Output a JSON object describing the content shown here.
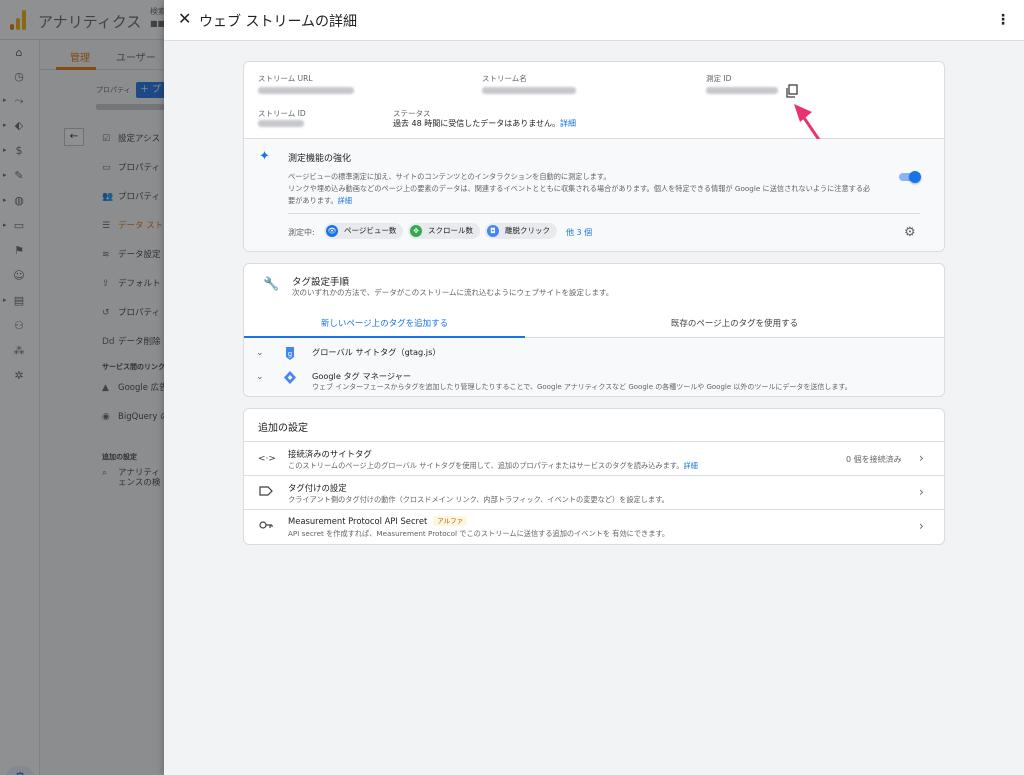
{
  "background": {
    "app_title": "アナリティクス",
    "account_lines": [
      "検索",
      "■■"
    ],
    "tabs": [
      "管理",
      "ユーザー"
    ],
    "property_label": "プロパティ",
    "create_button": "＋ プ",
    "menu": [
      {
        "icon": "☑",
        "label": "設定アシス"
      },
      {
        "icon": "▭",
        "label": "プロパティ"
      },
      {
        "icon": "👥",
        "label": "プロパティ"
      },
      {
        "icon": "☰",
        "label": "データ スト"
      },
      {
        "icon": "≋",
        "label": "データ設定"
      },
      {
        "icon": "⇪",
        "label": "デフォルト"
      },
      {
        "icon": "↺",
        "label": "プロパティ"
      },
      {
        "icon": "Dd",
        "label": "データ削除"
      }
    ],
    "section_links": "サービス間のリンク",
    "links": [
      {
        "label": "Google 広告"
      },
      {
        "label": "BigQuery の"
      }
    ],
    "section_extra": "追加の設定",
    "extra_item": {
      "label_1": "アナリティ",
      "label_2": "ェンスの検"
    }
  },
  "panel": {
    "title": "ウェブ ストリームの詳細",
    "close_glyph": "✕",
    "more_glyph": "⋮"
  },
  "details": {
    "stream_url_label": "ストリーム URL",
    "stream_name_label": "ストリーム名",
    "measurement_id_label": "測定 ID",
    "stream_id_label": "ストリーム ID",
    "status_label": "ステータス",
    "status_text": "過去 48 時間に受信したデータはありません。",
    "status_link": "詳細"
  },
  "enhanced": {
    "title": "測定機能の強化",
    "desc_1": "ページビューの標準測定に加え、サイトのコンテンツとのインタラクションを自動的に測定します。",
    "desc_2": "リンクや埋め込み動画などのページ上の要素のデータは、関連するイベントとともに収集される場合があります。個人を特定できる情報が Google に送信されないように注意する必",
    "desc_3": "要があります。",
    "desc_link": "詳細",
    "toggle_on": true,
    "measuring_label": "測定中:",
    "chips": [
      {
        "label": "ページビュー数",
        "icon": "page-view-icon"
      },
      {
        "label": "スクロール数",
        "icon": "scroll-icon"
      },
      {
        "label": "離脱クリック",
        "icon": "mouse-click-icon"
      }
    ],
    "more_link": "他 3 個"
  },
  "tagging": {
    "title": "タグ設定手順",
    "desc": "次のいずれかの方法で、データがこのストリームに流れ込むようにウェブサイトを設定します。",
    "tab_new": "新しいページ上のタグを追加する",
    "tab_existing": "既存のページ上のタグを使用する",
    "rows": [
      {
        "title": "グローバル サイトタグ（gtag.js）",
        "desc": ""
      },
      {
        "title": "Google タグ マネージャー",
        "desc": "ウェブ インターフェースからタグを追加したり管理したりすることで、Google アナリティクスなど Google の各種ツールや Google 以外のツールにデータを送信します。"
      }
    ]
  },
  "additional": {
    "title": "追加の設定",
    "rows": [
      {
        "icon": "code-icon",
        "glyph": "<·>",
        "title": "接続済みのサイトタグ",
        "desc": "このストリームのページ上のグローバル サイトタグを使用して、追加のプロパティまたはサービスのタグを読み込みます。",
        "link": "詳細",
        "count": "0 個を接続済み"
      },
      {
        "icon": "label-icon",
        "glyph": "▭",
        "title": "タグ付けの設定",
        "desc": "クライアント側のタグ付けの動作（クロスドメイン リンク、内部トラフィック、イベントの変更など）を設定します。"
      },
      {
        "icon": "key-icon",
        "glyph": "⚿",
        "title": "Measurement Protocol API Secret",
        "badge": "アルファ",
        "desc": "API secret を作成すれば、Measurement Protocol でこのストリームに送信する追加のイベントを 有効にできます。"
      }
    ]
  },
  "colors": {
    "accent": "#1a73e8",
    "ga_orange": "#e37400",
    "arrow": "#e8336f"
  }
}
